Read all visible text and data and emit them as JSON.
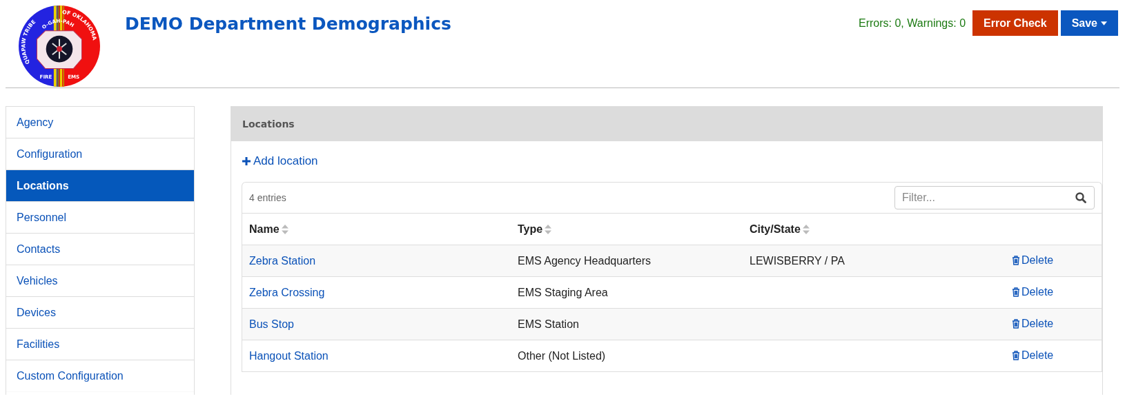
{
  "logo": {
    "arc_left": "QUAPAW TRIBE",
    "arc_right": "OF OKLAHOMA",
    "motto": "O-GAH-PAH",
    "bottom_left": "FIRE",
    "bottom_right": "EMS"
  },
  "title": "DEMO Department Demographics",
  "status": "Errors: 0, Warnings: 0",
  "buttons": [
    {
      "label": "Error Check",
      "kind": "danger",
      "dropdown": false
    },
    {
      "label": "Save",
      "kind": "primary",
      "dropdown": true
    }
  ],
  "sidebar": {
    "items": [
      {
        "label": "Agency",
        "selected": false
      },
      {
        "label": "Configuration",
        "selected": false
      },
      {
        "label": "Locations",
        "selected": true
      },
      {
        "label": "Personnel",
        "selected": false
      },
      {
        "label": "Contacts",
        "selected": false
      },
      {
        "label": "Vehicles",
        "selected": false
      },
      {
        "label": "Devices",
        "selected": false
      },
      {
        "label": "Facilities",
        "selected": false
      },
      {
        "label": "Custom Configuration",
        "selected": false
      }
    ]
  },
  "panel": {
    "title": "Locations",
    "add_link": "Add location",
    "table": {
      "count": "4 entries",
      "filter": {
        "placeholder": "Filter..."
      },
      "columns": [
        "Name",
        "Type",
        "City/State"
      ],
      "rows": [
        {
          "name": "Zebra Station",
          "type": "EMS Agency Headquarters",
          "city_state": "LEWISBERRY / PA",
          "action": "Delete"
        },
        {
          "name": "Zebra Crossing",
          "type": "EMS Staging Area",
          "city_state": "",
          "action": "Delete"
        },
        {
          "name": "Bus Stop",
          "type": "EMS Station",
          "city_state": "",
          "action": "Delete"
        },
        {
          "name": "Hangout Station",
          "type": "Other (Not Listed)",
          "city_state": "",
          "action": "Delete"
        }
      ]
    }
  }
}
